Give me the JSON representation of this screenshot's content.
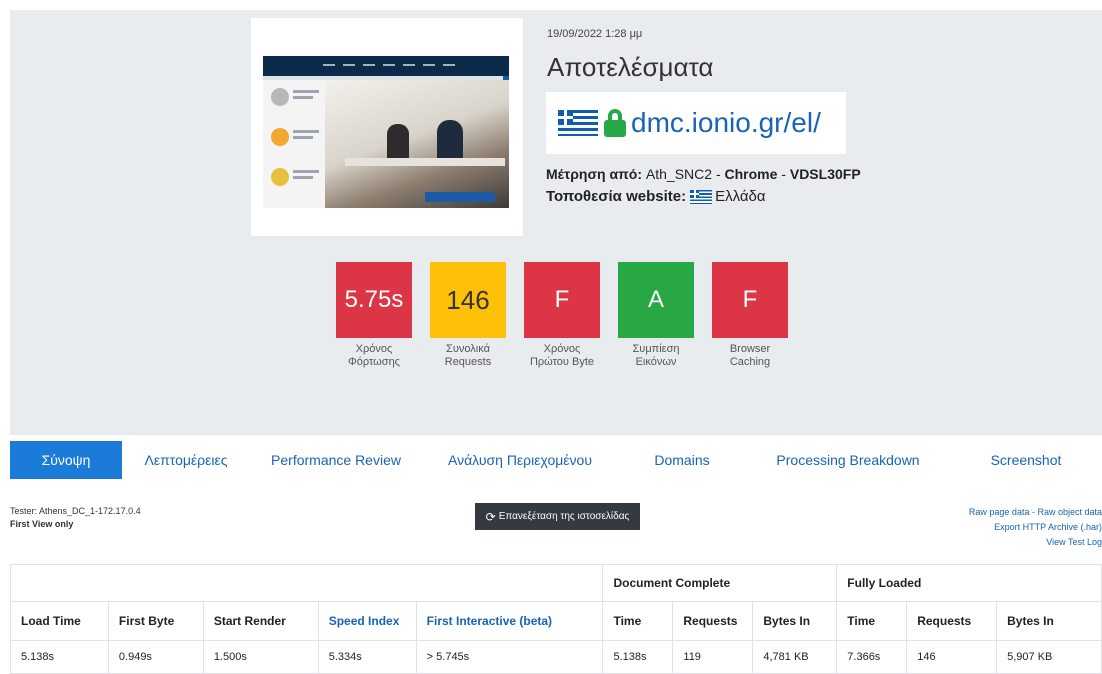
{
  "test": {
    "datetime": "19/09/2022 1:28 μμ",
    "title": "Αποτελέσματα",
    "url": "dmc.ionio.gr/el/",
    "measured_by_label": "Μέτρηση από:",
    "measured_by_location": "Ath_SNC2",
    "separator": "-",
    "browser": "Chrome",
    "connection": "VDSL30FP",
    "site_location_label": "Τοποθεσία website:",
    "site_location_value": "Ελλάδα"
  },
  "grades": [
    {
      "value": "5.75s",
      "label1": "Χρόνος",
      "label2": "Φόρτωσης",
      "color": "#dc3545"
    },
    {
      "value": "146",
      "label1": "Συνολικά",
      "label2": "Requests",
      "color": "#ffc107"
    },
    {
      "value": "F",
      "label1": "Χρόνος",
      "label2": "Πρώτου Byte",
      "color": "#dc3545"
    },
    {
      "value": "A",
      "label1": "Συμπίεση",
      "label2": "Εικόνων",
      "color": "#28a745"
    },
    {
      "value": "F",
      "label1": "Browser",
      "label2": "Caching",
      "color": "#dc3545"
    }
  ],
  "tabs": [
    "Σύνοψη",
    "Λεπτομέρειες",
    "Performance Review",
    "Ανάλυση Περιεχομένου",
    "Domains",
    "Processing Breakdown",
    "Screenshot"
  ],
  "tester": {
    "line1": "Tester: Athens_DC_1-172.17.0.4",
    "line2": "First View only"
  },
  "retest_label": "Επανεξέταση της ιστοσελίδας",
  "links": {
    "line1": "Raw page data - Raw object data",
    "line2": "Export HTTP Archive (.har)",
    "line3": "View Test Log"
  },
  "table": {
    "group_document": "Document Complete",
    "group_fully": "Fully Loaded",
    "headers": [
      "Load Time",
      "First Byte",
      "Start Render",
      "Speed Index",
      "First Interactive (beta)",
      "Time",
      "Requests",
      "Bytes In",
      "Time",
      "Requests",
      "Bytes In"
    ],
    "values": [
      "5.138s",
      "0.949s",
      "1.500s",
      "5.334s",
      "> 5.745s",
      "5.138s",
      "119",
      "4,781 KB",
      "7.366s",
      "146",
      "5,907 KB"
    ]
  },
  "icons": [
    "greece-flag-icon",
    "lock-icon",
    "refresh-icon"
  ],
  "colors": {
    "accent": "#1a7bd9",
    "hero_bg": "#e9ecef",
    "link": "#1a63b5",
    "success": "#27a745"
  }
}
